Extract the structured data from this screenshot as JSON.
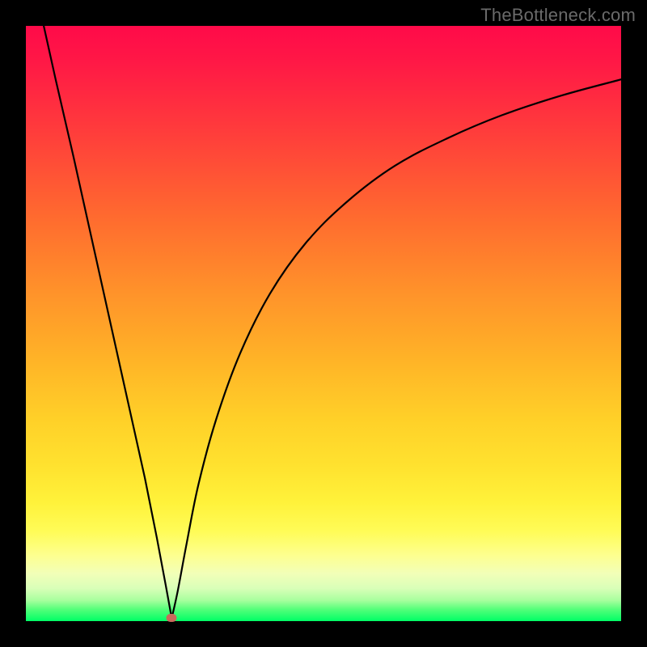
{
  "attribution": "TheBottleneck.com",
  "colors": {
    "frame": "#000000",
    "curve": "#000000",
    "marker": "#c9695b"
  },
  "chart_data": {
    "type": "line",
    "title": "",
    "xlabel": "",
    "ylabel": "",
    "xlim": [
      0,
      100
    ],
    "ylim": [
      0,
      100
    ],
    "grid": false,
    "legend": false,
    "description": "V-shaped bottleneck curve on a red-to-green vertical gradient. Left branch descends steeply and roughly linearly from top-left to the minimum; right branch rises with decreasing slope toward the upper-right. Minimum marked by a small rounded dot near the baseline.",
    "series": [
      {
        "name": "left-branch",
        "x": [
          3,
          5,
          8,
          11,
          14,
          17,
          20,
          22,
          23.5,
          24.5
        ],
        "y": [
          100,
          91,
          78,
          64.5,
          51,
          37.5,
          24,
          14,
          6,
          0.5
        ]
      },
      {
        "name": "right-branch",
        "x": [
          24.5,
          25.5,
          27,
          29,
          32,
          36,
          41,
          47,
          54,
          62,
          71,
          80,
          90,
          100
        ],
        "y": [
          0.5,
          5,
          13,
          23,
          34,
          45,
          55,
          63.5,
          70.5,
          76.5,
          81.2,
          85,
          88.3,
          91
        ]
      }
    ],
    "marker": {
      "x": 24.5,
      "y": 0.5
    }
  }
}
